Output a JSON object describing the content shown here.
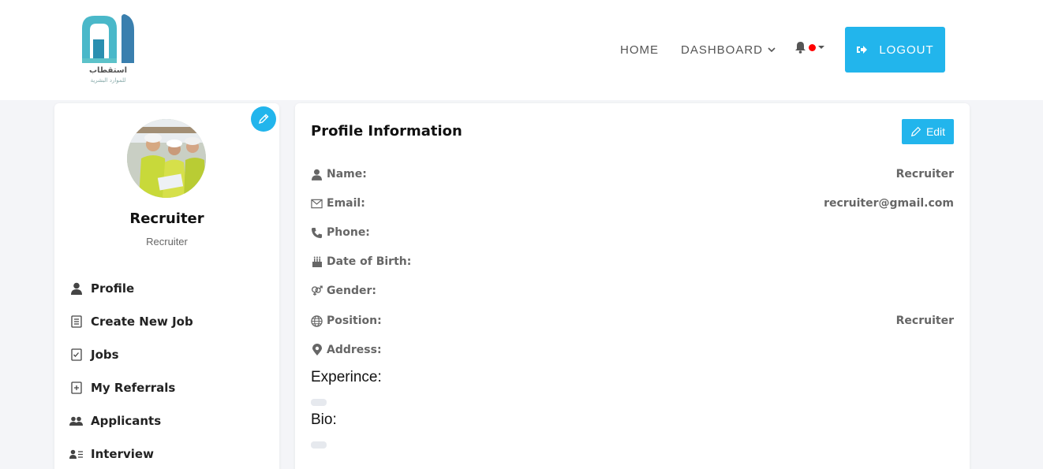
{
  "brand": {
    "name_ar": "استقطاب",
    "sub_ar": "للموارد البشرية",
    "primary_color": "#22b5ec"
  },
  "nav": {
    "home": "HOME",
    "dashboard": "DASHBOARD",
    "logout": "LOGOUT",
    "notification_icon": "bell-icon"
  },
  "profile": {
    "name": "Recruiter",
    "role": "Recruiter"
  },
  "menu": [
    {
      "label": "Profile",
      "icon": "user-icon"
    },
    {
      "label": "Create New Job",
      "icon": "list-icon"
    },
    {
      "label": "Jobs",
      "icon": "checklist-icon"
    },
    {
      "label": "My Referrals",
      "icon": "referral-icon"
    },
    {
      "label": "Applicants",
      "icon": "users-icon"
    },
    {
      "label": "Interview",
      "icon": "user-list-icon"
    }
  ],
  "info": {
    "title": "Profile Information",
    "edit_label": "Edit",
    "rows": [
      {
        "label": "Name:",
        "value": "Recruiter",
        "icon": "user-icon"
      },
      {
        "label": "Email:",
        "value": "recruiter@gmail.com",
        "icon": "envelope-icon"
      },
      {
        "label": "Phone:",
        "value": "",
        "icon": "phone-icon"
      },
      {
        "label": "Date of Birth:",
        "value": "",
        "icon": "cake-icon"
      },
      {
        "label": "Gender:",
        "value": "",
        "icon": "gender-icon"
      },
      {
        "label": "Position:",
        "value": "Recruiter",
        "icon": "globe-icon"
      },
      {
        "label": "Address:",
        "value": "",
        "icon": "map-pin-icon"
      }
    ],
    "experience_label": "Experince:",
    "bio_label": "Bio:"
  }
}
